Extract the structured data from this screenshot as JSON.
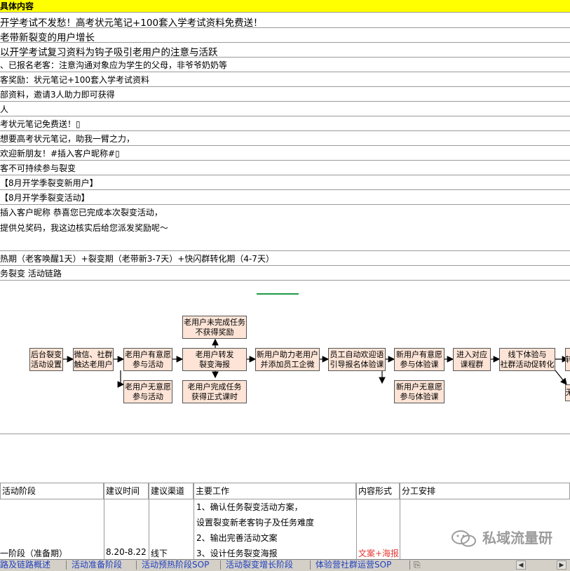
{
  "sheet": {
    "header": "具体内容",
    "rows": [
      {
        "text": "开学考试不发愁！高考状元笔记+100套入学考试资料免费送！",
        "big": true
      },
      {
        "text": " 老带新裂变的用户增长",
        "big": true
      },
      {
        "text": " 以开学考试复习资料为钩子吸引老用户的注意与活跃",
        "big": true
      },
      {
        "text": "、已报名老客：注意沟通对象应为学生的父母，非爷爷奶奶等",
        "big": false
      },
      {
        "text": "客奖励：状元笔记+100套入学考试资料",
        "big": false
      },
      {
        "text": "部资料，邀请3人助力即可获得",
        "big": false
      },
      {
        "text": "人",
        "big": false
      },
      {
        "text": "考状元笔记免费送！▯",
        "big": false
      },
      {
        "text": "想要高考状元笔记，助我一臂之力，",
        "big": false
      },
      {
        "text": "欢迎新朋友！#插入客户昵称#▯",
        "big": false
      },
      {
        "text": "客不可持续参与裂变",
        "big": false
      },
      {
        "text": "【8月开学季裂变新用户】",
        "big": false
      },
      {
        "text": "【8月开学季裂变活动】",
        "big": false
      },
      {
        "text": "插入客户昵称 恭喜您已完成本次裂变活动，",
        "text2": "提供兑奖码，我这边核实后给您派发奖励呢～",
        "big": false
      },
      {
        "text": "热期（老客唤醒1天）+裂变期（老带新3-7天）+快闪群转化期（4-7天）",
        "big": false
      },
      {
        "text": "务裂变 活动链路",
        "big": false
      }
    ]
  },
  "flow": {
    "nodes": {
      "n1": [
        "后台裂变",
        "活动设置"
      ],
      "n2": [
        "微信、社群",
        "触达老用户"
      ],
      "n3": [
        "老用户有意愿",
        "参与活动"
      ],
      "n3b": [
        "老用户无意愿",
        "参与活动"
      ],
      "n4top": [
        "老用户未完成任务",
        "不获得奖励"
      ],
      "n4": [
        "老用户转发",
        "裂变海报"
      ],
      "n4b": [
        "老用户完成任务",
        "获得正式课时"
      ],
      "n5": [
        "新用户助力老用户",
        "并添加员工企微"
      ],
      "n6": [
        "员工自动欢迎语",
        "引导报名体验课"
      ],
      "n7": [
        "新用户有意愿",
        "参与体验课"
      ],
      "n7b": [
        "新用户无意愿",
        "参与体验课"
      ],
      "n8": [
        "进入对应",
        "课程群"
      ],
      "n9": [
        "线下体验与",
        "社群活动促转化"
      ],
      "n10": [
        "转"
      ],
      "n10b": [
        "无"
      ]
    }
  },
  "table": {
    "headers": [
      "活动阶段",
      "建议时间",
      "建议渠道",
      "主要工作",
      "内容形式",
      "分工安排"
    ],
    "stage": "一阶段（准备期）",
    "time": "8.20-8.22",
    "channel": "线下",
    "work": [
      "1、确认任务裂变活动方案，",
      "设置裂变新老客钩子及任务难度",
      "2、输出完善活动文案",
      "3、设计任务裂变海报"
    ],
    "content_form": "文案+海报"
  },
  "tabs": [
    "路及链路概述",
    "活动准备阶段",
    "活动预热阶段SOP",
    "活动裂变增长阶段",
    "体验营社群运营SOP"
  ],
  "watermark": "私域流量研",
  "colors": {
    "header_bg": "#ffff00",
    "box_fill": "#fde4d6",
    "accent_green": "#1e9a47",
    "content_red": "#e53935",
    "tab_text": "#1f3fbf"
  }
}
